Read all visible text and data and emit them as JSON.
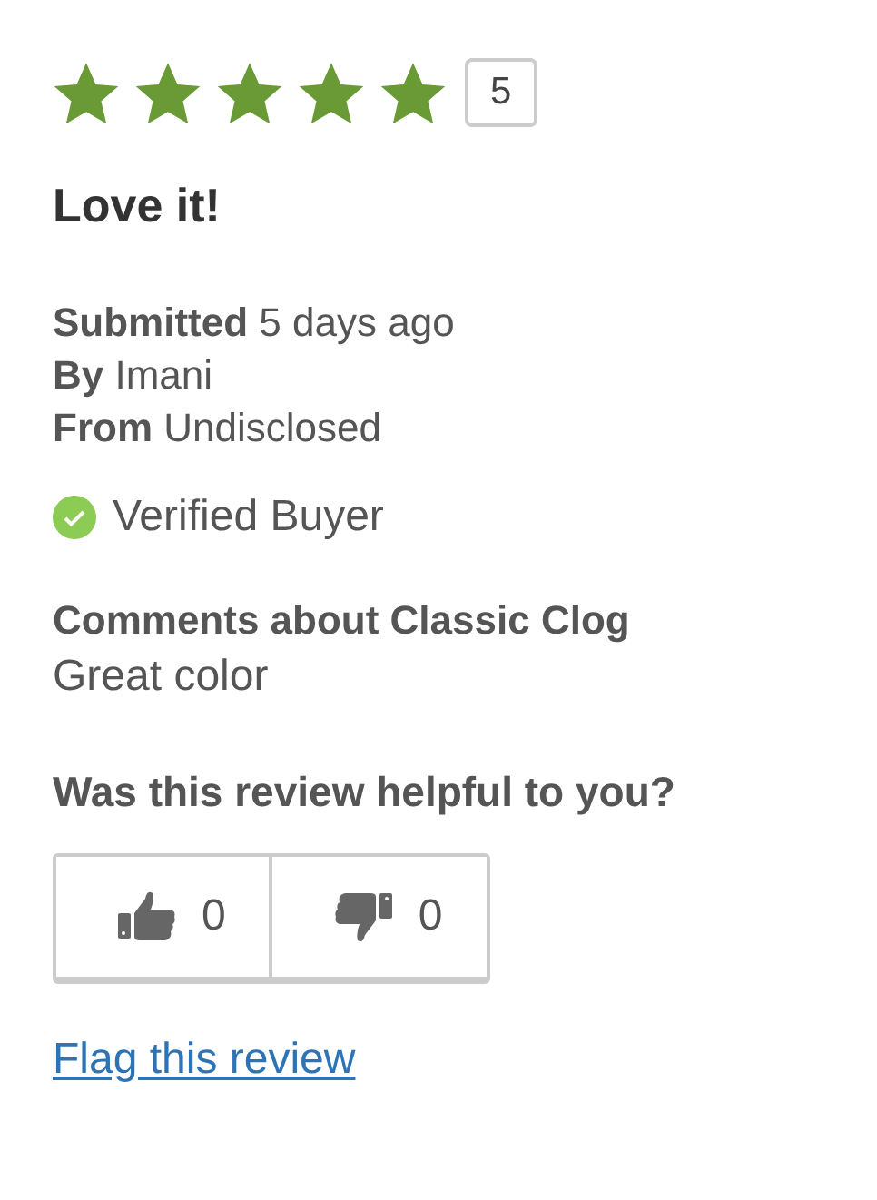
{
  "rating": {
    "stars": 5,
    "count": "5"
  },
  "title": "Love it!",
  "meta": [
    "**Submitted** 5 days ago",
    "**By** Imani",
    "**From** Undisclosed"
  ],
  "verified": {
    "label": "Verified Buyer"
  },
  "comments": {
    "heading": "Comments about Classic Clog",
    "text": "Great color"
  },
  "helpful": {
    "question": "Was this review helpful to you?",
    "votes": [
      {
        "kind": "up",
        "count": "0"
      },
      {
        "kind": "down",
        "count": "0"
      }
    ]
  },
  "flag_link": "Flag this review"
}
